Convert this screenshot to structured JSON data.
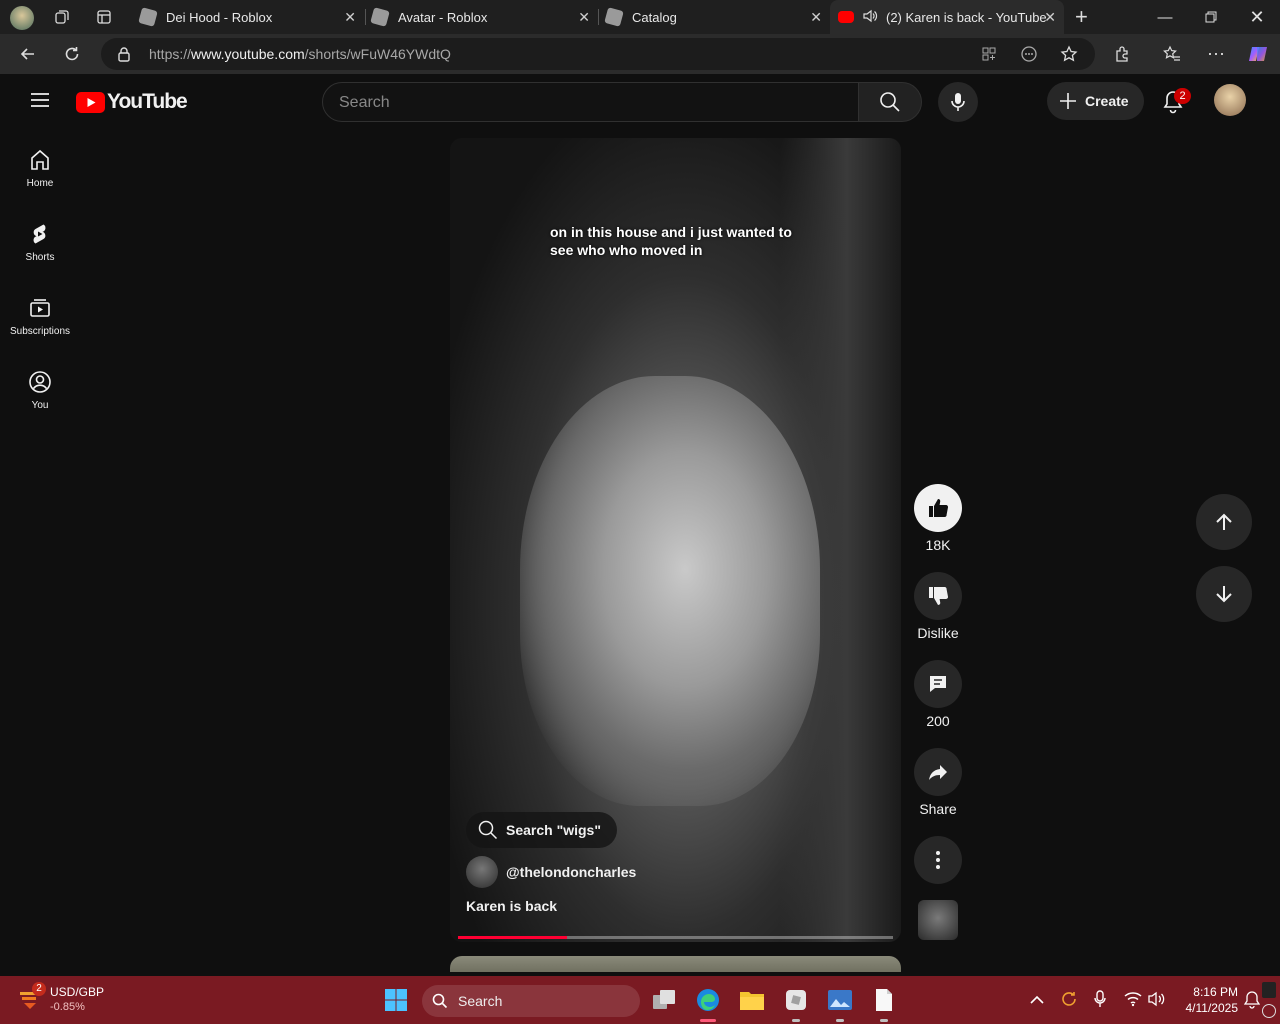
{
  "browser": {
    "tabs": [
      {
        "title": "Dei Hood - Roblox"
      },
      {
        "title": "Avatar - Roblox"
      },
      {
        "title": "Catalog"
      },
      {
        "title": "(2) Karen is back - YouTube"
      }
    ],
    "url_prefix": "https://",
    "url_host": "www.youtube.com",
    "url_path": "/shorts/wFuW46YWdtQ"
  },
  "youtube": {
    "logo_text": "YouTube",
    "search_placeholder": "Search",
    "create_label": "Create",
    "notification_count": "2",
    "nav": [
      {
        "label": "Home"
      },
      {
        "label": "Shorts"
      },
      {
        "label": "Subscriptions"
      },
      {
        "label": "You"
      }
    ]
  },
  "short": {
    "caption": "on in this house and i just wanted to see who who moved in",
    "search_chip": "Search \"wigs\"",
    "channel": "@thelondoncharles",
    "title": "Karen is back",
    "progress": 0.25,
    "likes": "18K",
    "dislike_label": "Dislike",
    "comments": "200",
    "share_label": "Share"
  },
  "taskbar": {
    "widget_badge": "2",
    "ticker_name": "USD/GBP",
    "ticker_change": "-0.85%",
    "search_label": "Search",
    "time": "8:16 PM",
    "date": "4/11/2025"
  }
}
